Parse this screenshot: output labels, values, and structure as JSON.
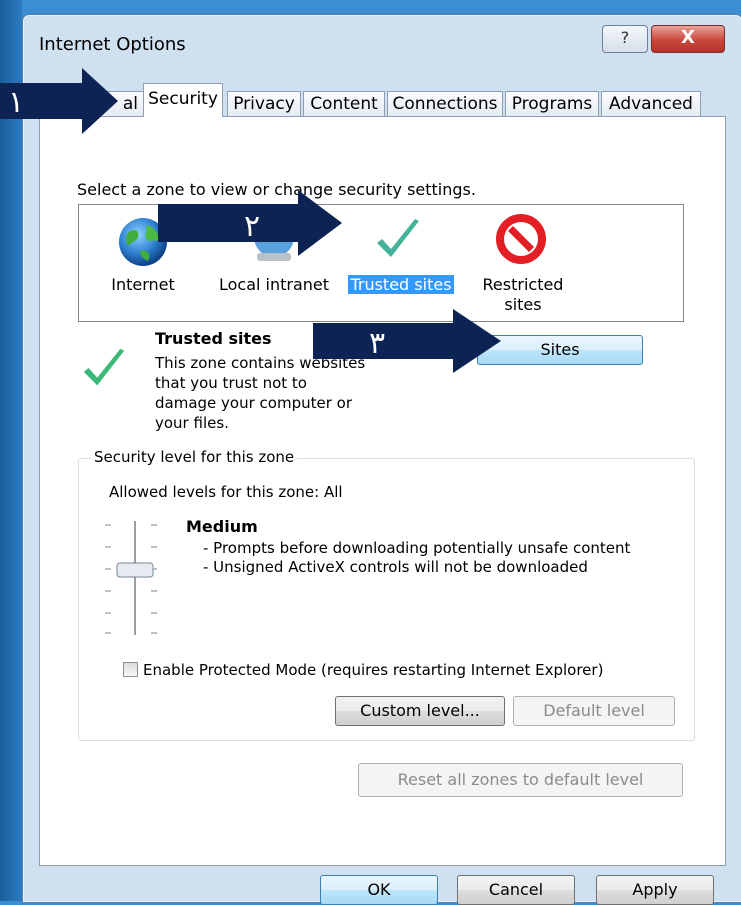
{
  "window": {
    "title": "Internet Options",
    "help_glyph": "?",
    "close_glyph": "X"
  },
  "tabs": [
    {
      "label": "al"
    },
    {
      "label": "Security"
    },
    {
      "label": "Privacy"
    },
    {
      "label": "Content"
    },
    {
      "label": "Connections"
    },
    {
      "label": "Programs"
    },
    {
      "label": "Advanced"
    }
  ],
  "zones": {
    "prompt": "Select a zone to view or change security settings.",
    "items": [
      {
        "label": "Internet",
        "icon": "globe-icon"
      },
      {
        "label": "Local intranet",
        "icon": "intranet-globe-icon"
      },
      {
        "label": "Trusted sites",
        "icon": "checkmark-icon"
      },
      {
        "label": "Restricted sites",
        "label_line1": "Restricted",
        "label_line2": "sites",
        "icon": "no-entry-icon"
      }
    ],
    "selected_index": 2
  },
  "selected_zone": {
    "title": "Trusted sites",
    "description": "This zone contains websites that you trust not to damage your computer or your files.",
    "sites_button": "Sites"
  },
  "security_level": {
    "group_title": "Security level for this zone",
    "allowed": "Allowed levels for this zone: All",
    "level_name": "Medium",
    "bullet1": "- Prompts before downloading potentially unsafe content",
    "bullet2": "- Unsigned ActiveX controls will not be downloaded",
    "protected_mode_label": "Enable Protected Mode (requires restarting Internet Explorer)",
    "protected_mode_checked": false,
    "custom_level_button": "Custom level...",
    "default_level_button": "Default level"
  },
  "reset_button": "Reset all zones to default level",
  "footer": {
    "ok": "OK",
    "cancel": "Cancel",
    "apply": "Apply"
  },
  "annotations": [
    {
      "number": "١"
    },
    {
      "number": "٢"
    },
    {
      "number": "٣"
    }
  ],
  "colors": {
    "desktop_blue": "#2f7fc4",
    "selection_blue": "#3399ff",
    "arrow_navy": "#0d2354",
    "check_green": "#3cb878"
  }
}
